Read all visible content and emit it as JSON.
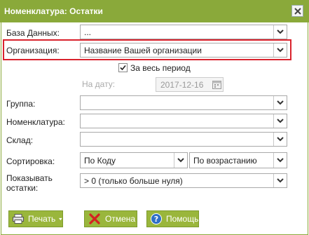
{
  "window": {
    "title": "Номенклатура: Остатки"
  },
  "form": {
    "database": {
      "label": "База Данных:",
      "value": "..."
    },
    "organization": {
      "label": "Организация:",
      "value": "Название Вашей организации"
    },
    "whole_period": {
      "label": "За весь период",
      "checked": true
    },
    "date": {
      "label": "На дату:",
      "value": "2017-12-16"
    },
    "group": {
      "label": "Группа:",
      "value": ""
    },
    "nomenclature": {
      "label": "Номенклатура:",
      "value": ""
    },
    "warehouse": {
      "label": "Склад:",
      "value": ""
    },
    "sorting": {
      "label": "Сортировка:",
      "field": "По Коду",
      "direction": "По возрастанию"
    },
    "show_balance": {
      "label_line1": "Показывать",
      "label_line2": "остатки:",
      "value": "> 0 (только больше нуля)"
    }
  },
  "buttons": {
    "print": "Печать",
    "cancel": "Отмена",
    "help": "Помощь"
  },
  "colors": {
    "accent": "#8aa93a",
    "button": "#9ab63c",
    "highlight": "#d9232d"
  },
  "icons": [
    "close-icon",
    "chevron-down-icon",
    "checkmark-icon",
    "calendar-icon",
    "printer-icon",
    "cancel-x-icon",
    "help-icon"
  ]
}
